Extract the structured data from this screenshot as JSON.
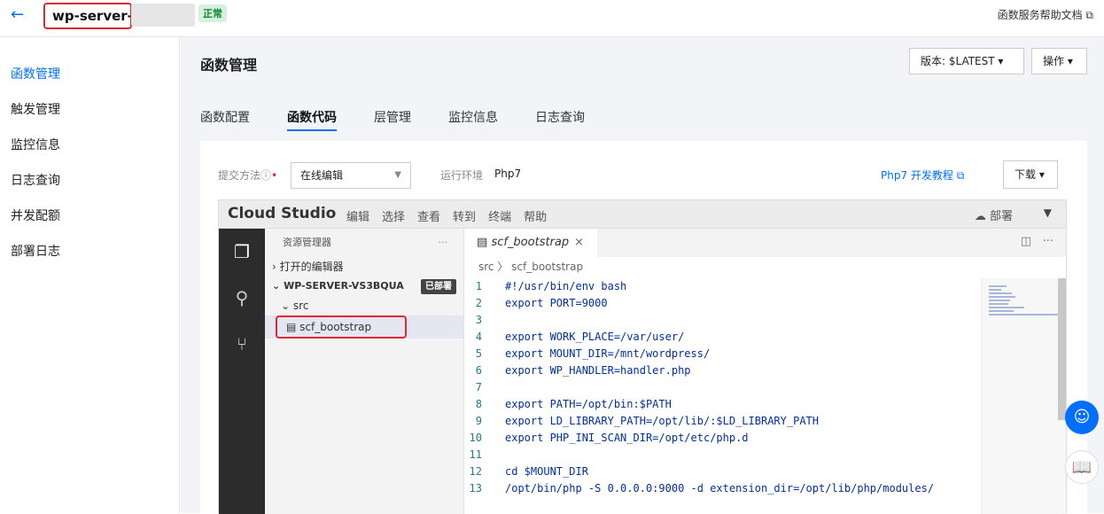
{
  "header": {
    "back_icon": "arrow-left-icon",
    "function_name": "wp-server-",
    "status_badge": "正常",
    "help_link": "函数服务帮助文档 ⧉"
  },
  "sidebar": {
    "items": [
      {
        "label": "函数管理",
        "active": true
      },
      {
        "label": "触发管理"
      },
      {
        "label": "监控信息"
      },
      {
        "label": "日志查询"
      },
      {
        "label": "并发配额"
      },
      {
        "label": "部署日志"
      }
    ]
  },
  "main": {
    "title": "函数管理",
    "version_button": "版本: $LATEST ▾",
    "ops_button": "操作 ▾",
    "tabs": [
      {
        "label": "函数配置"
      },
      {
        "label": "函数代码",
        "active": true
      },
      {
        "label": "层管理"
      },
      {
        "label": "监控信息"
      },
      {
        "label": "日志查询"
      }
    ]
  },
  "panel": {
    "submit_label": "提交方法",
    "submit_value": "在线编辑",
    "env_label": "运行环境",
    "env_value": "Php7",
    "tutorial_link": "Php7 开发教程 ⧉",
    "download_button": "下载 ▾"
  },
  "ide": {
    "brand": "Cloud Studio",
    "menu": [
      "编辑",
      "选择",
      "查看",
      "转到",
      "终端",
      "帮助"
    ],
    "deploy": "部署",
    "explorer_title": "资源管理器",
    "explorer_more": "···",
    "open_editors": "打开的编辑器",
    "project": "WP-SERVER-VS3BQUA",
    "deployed_badge": "已部署",
    "folder": "src",
    "file": "scf_bootstrap",
    "tab_name": "scf_bootstrap",
    "breadcrumb": "src  〉  scf_bootstrap",
    "code": [
      {
        "n": "1",
        "t": "#!/usr/bin/env bash"
      },
      {
        "n": "2",
        "t": "export PORT=9000"
      },
      {
        "n": "3",
        "t": ""
      },
      {
        "n": "4",
        "t": "export WORK_PLACE=/var/user/"
      },
      {
        "n": "5",
        "t": "export MOUNT_DIR=/mnt/wordpress/"
      },
      {
        "n": "6",
        "t": "export WP_HANDLER=handler.php"
      },
      {
        "n": "7",
        "t": ""
      },
      {
        "n": "8",
        "t": "export PATH=/opt/bin:$PATH"
      },
      {
        "n": "9",
        "t": "export LD_LIBRARY_PATH=/opt/lib/:$LD_LIBRARY_PATH"
      },
      {
        "n": "10",
        "t": "export PHP_INI_SCAN_DIR=/opt/etc/php.d"
      },
      {
        "n": "11",
        "t": ""
      },
      {
        "n": "12",
        "t": "cd $MOUNT_DIR"
      },
      {
        "n": "13",
        "t": "/opt/bin/php -S 0.0.0.0:9000 -d extension_dir=/opt/lib/php/modules/"
      }
    ]
  }
}
